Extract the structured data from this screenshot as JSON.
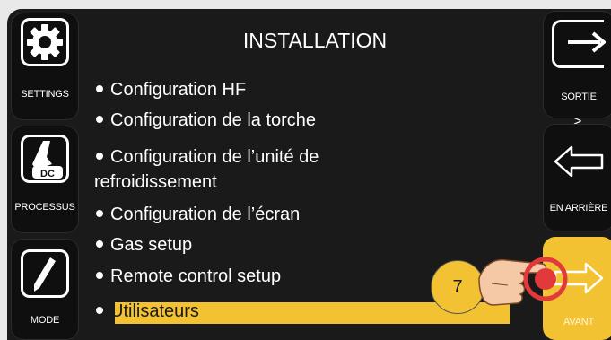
{
  "screen": {
    "title": "INSTALLATION"
  },
  "left_buttons": [
    {
      "label": "SETTINGS",
      "icon": "gear-icon"
    },
    {
      "label": "PROCESSUS",
      "icon": "torch-dc-icon",
      "badge": "DC"
    },
    {
      "label": "MODE",
      "icon": "mode-slash-icon"
    }
  ],
  "right_buttons": [
    {
      "label": "SORTIE",
      "icon": "exit-arrow-icon"
    },
    {
      "label": "EN ARRIÈRE",
      "icon": "back-arrow-icon"
    },
    {
      "label": "AVANT",
      "icon": "forward-arrow-icon",
      "active": true
    }
  ],
  "menu": {
    "items": [
      {
        "label": "Configuration HF"
      },
      {
        "label": "Configuration de la torche"
      },
      {
        "label": "Configuration de l’unité de",
        "label_cont": "refroidissement"
      },
      {
        "label": "Configuration de l’écran"
      },
      {
        "label": "Gas setup"
      },
      {
        "label": "Remote control setup"
      },
      {
        "label": "Utilisateurs",
        "selected": true
      }
    ],
    "chevron": ">"
  },
  "callout": {
    "number": "7",
    "icon": "hand-pointer-icon"
  },
  "colors": {
    "background": "#1a1a1a",
    "accent": "#f2c232",
    "callout_red": "#e2393c"
  }
}
